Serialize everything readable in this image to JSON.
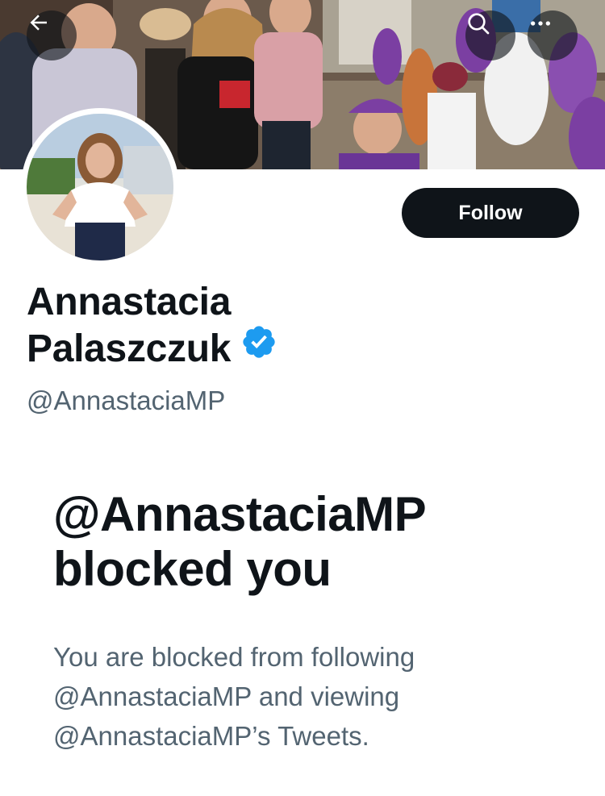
{
  "profile": {
    "display_name_line1": "Annastacia",
    "display_name_line2": "Palaszczuk",
    "handle": "@AnnastaciaMP",
    "verified_icon": "verified-badge-icon",
    "verified_color": "#1d9bf0"
  },
  "header": {
    "back_icon": "arrow-left-icon",
    "search_icon": "search-icon",
    "more_icon": "more-horizontal-icon"
  },
  "actions": {
    "follow_label": "Follow"
  },
  "blocked": {
    "title_line1": "@AnnastaciaMP",
    "title_line2": "blocked you",
    "description_line1": "You are blocked from following",
    "description_line2": "@AnnastaciaMP and viewing",
    "description_line3": "@AnnastaciaMP’s Tweets."
  },
  "colors": {
    "text_primary": "#0f1419",
    "text_secondary": "#536471",
    "button_bg": "#0f1419"
  }
}
